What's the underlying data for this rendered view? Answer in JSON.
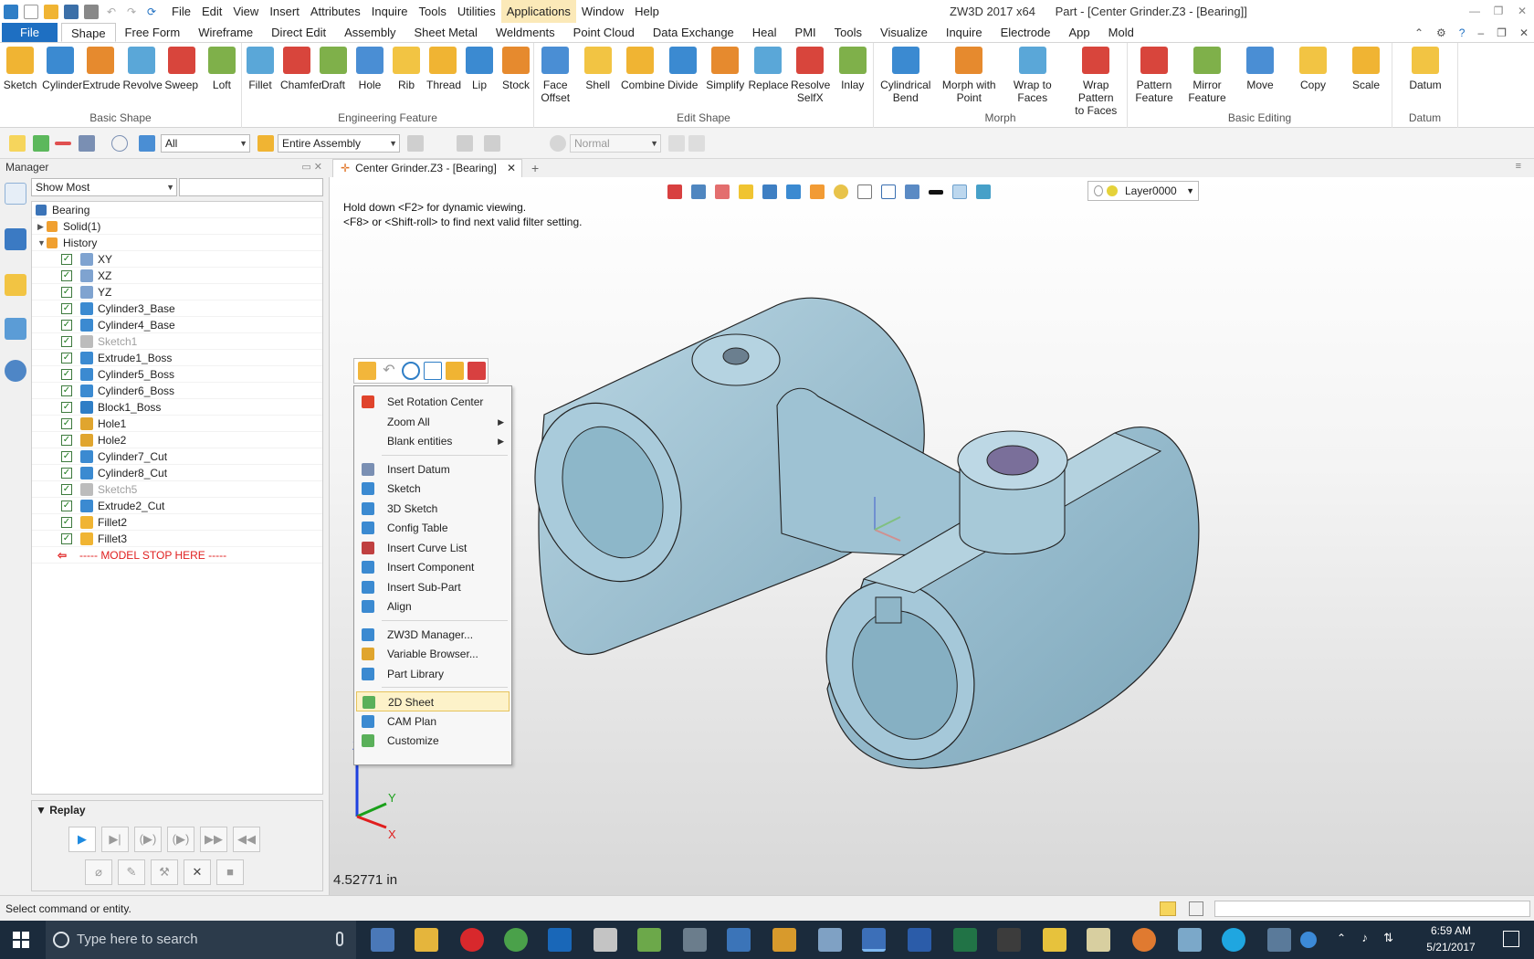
{
  "title_bar": {
    "menus": [
      "File",
      "Edit",
      "View",
      "Insert",
      "Attributes",
      "Inquire",
      "Tools",
      "Utilities",
      "Applications",
      "Window",
      "Help"
    ],
    "highlighted_menu": "Applications",
    "app_title": "ZW3D 2017  x64",
    "doc_title": "Part - [Center Grinder.Z3 - [Bearing]]"
  },
  "ribbon_tabs": {
    "file": "File",
    "tabs": [
      "Shape",
      "Free Form",
      "Wireframe",
      "Direct Edit",
      "Assembly",
      "Sheet Metal",
      "Weldments",
      "Point Cloud",
      "Data Exchange",
      "Heal",
      "PMI",
      "Tools",
      "Visualize",
      "Inquire",
      "Electrode",
      "App",
      "Mold"
    ],
    "active": "Shape"
  },
  "ribbon": {
    "groups": [
      {
        "label": "Basic Shape",
        "buttons": [
          [
            "Sketch",
            ""
          ],
          [
            "Cylinder",
            ""
          ],
          [
            "Extrude",
            ""
          ],
          [
            "Revolve",
            ""
          ],
          [
            "Sweep",
            ""
          ],
          [
            "Loft",
            ""
          ]
        ]
      },
      {
        "label": "Engineering Feature",
        "buttons": [
          [
            "Fillet",
            ""
          ],
          [
            "Chamfer",
            ""
          ],
          [
            "Draft",
            ""
          ],
          [
            "Hole",
            ""
          ],
          [
            "Rib",
            ""
          ],
          [
            "Thread",
            ""
          ],
          [
            "Lip",
            ""
          ],
          [
            "Stock",
            ""
          ]
        ]
      },
      {
        "label": "Edit Shape",
        "buttons": [
          [
            "Face",
            "Offset"
          ],
          [
            "Shell",
            ""
          ],
          [
            "Combine",
            ""
          ],
          [
            "Divide",
            ""
          ],
          [
            "Simplify",
            ""
          ],
          [
            "Replace",
            ""
          ],
          [
            "Resolve",
            "SelfX"
          ],
          [
            "Inlay",
            ""
          ]
        ]
      },
      {
        "label": "Morph",
        "buttons": [
          [
            "Cylindrical",
            "Bend"
          ],
          [
            "Morph with",
            "Point"
          ],
          [
            "Wrap to",
            "Faces"
          ],
          [
            "Wrap Pattern",
            "to Faces"
          ]
        ]
      },
      {
        "label": "Basic Editing",
        "buttons": [
          [
            "Pattern",
            "Feature"
          ],
          [
            "Mirror",
            "Feature"
          ],
          [
            "Move",
            ""
          ],
          [
            "Copy",
            ""
          ],
          [
            "Scale",
            ""
          ]
        ]
      },
      {
        "label": "Datum",
        "buttons": [
          [
            "Datum",
            ""
          ]
        ]
      }
    ]
  },
  "filter_bar": {
    "filter_value": "All",
    "scope_value": "Entire Assembly",
    "mode_value": "Normal"
  },
  "manager": {
    "title": "Manager",
    "show_mode": "Show Most",
    "tree": [
      {
        "label": "Bearing",
        "level": 0,
        "type": "root"
      },
      {
        "label": "Solid(1)",
        "level": 1,
        "type": "folder"
      },
      {
        "label": "History",
        "level": 1,
        "type": "folder"
      },
      {
        "label": "XY",
        "type": "datum",
        "checked": true
      },
      {
        "label": "XZ",
        "type": "datum",
        "checked": true
      },
      {
        "label": "YZ",
        "type": "datum",
        "checked": true
      },
      {
        "label": "Cylinder3_Base",
        "type": "cyl",
        "checked": true
      },
      {
        "label": "Cylinder4_Base",
        "type": "cyl",
        "checked": true
      },
      {
        "label": "Sketch1",
        "type": "sketch",
        "checked": true,
        "grey": true
      },
      {
        "label": "Extrude1_Boss",
        "type": "ext",
        "checked": true
      },
      {
        "label": "Cylinder5_Boss",
        "type": "cyl",
        "checked": true
      },
      {
        "label": "Cylinder6_Boss",
        "type": "cyl",
        "checked": true
      },
      {
        "label": "Block1_Boss",
        "type": "block",
        "checked": true
      },
      {
        "label": "Hole1",
        "type": "hole",
        "checked": true
      },
      {
        "label": "Hole2",
        "type": "hole",
        "checked": true
      },
      {
        "label": "Cylinder7_Cut",
        "type": "cyl",
        "checked": true
      },
      {
        "label": "Cylinder8_Cut",
        "type": "cyl",
        "checked": true
      },
      {
        "label": "Sketch5",
        "type": "sketch",
        "checked": true,
        "grey": true
      },
      {
        "label": "Extrude2_Cut",
        "type": "ext",
        "checked": true
      },
      {
        "label": "Fillet2",
        "type": "fillet",
        "checked": true
      },
      {
        "label": "Fillet3",
        "type": "fillet",
        "checked": true
      },
      {
        "label": "----- MODEL STOP HERE -----",
        "type": "stop"
      }
    ],
    "replay_title": "Replay"
  },
  "document": {
    "tab_label": "Center Grinder.Z3 - [Bearing]",
    "hint_line1": "Hold down <F2> for dynamic viewing.",
    "hint_line2": "<F8> or <Shift-roll> to find next valid filter setting.",
    "layer": "Layer0000",
    "measure": "4.52771 in",
    "axis_labels": [
      "Z",
      "Y",
      "X"
    ]
  },
  "context_menu": {
    "items": [
      {
        "label": "Set Rotation Center",
        "sub": false
      },
      {
        "label": "Zoom All",
        "sub": true
      },
      {
        "label": "Blank entities",
        "sub": true
      },
      {
        "sep": true
      },
      {
        "label": "Insert Datum"
      },
      {
        "label": "Sketch"
      },
      {
        "label": "3D Sketch"
      },
      {
        "label": "Config Table"
      },
      {
        "label": "Insert Curve List"
      },
      {
        "label": "Insert Component"
      },
      {
        "label": "Insert Sub-Part"
      },
      {
        "label": "Align"
      },
      {
        "sep": true
      },
      {
        "label": "ZW3D Manager..."
      },
      {
        "label": "Variable Browser..."
      },
      {
        "label": "Part Library"
      },
      {
        "sep": true
      },
      {
        "label": "2D Sheet",
        "selected": true
      },
      {
        "label": "CAM Plan"
      },
      {
        "label": "Customize"
      }
    ]
  },
  "status_bar": {
    "text": "Select command or entity."
  },
  "taskbar": {
    "search_placeholder": "Type here to search",
    "time": "6:59 AM",
    "date": "5/21/2017"
  },
  "colors": {
    "accent": "#1e6fc2",
    "part_fill": "#9dc3d3",
    "part_dark": "#6f9fb4",
    "menu_highlight": "#fdf2c9"
  }
}
